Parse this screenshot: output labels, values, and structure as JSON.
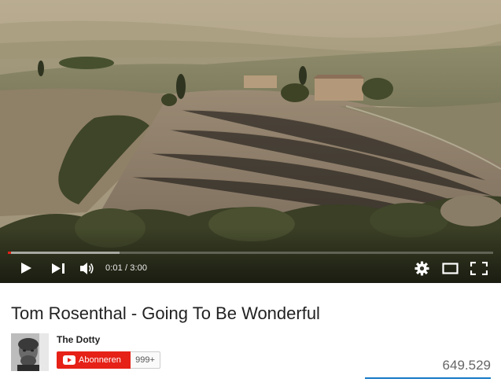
{
  "player": {
    "current_time": "0:01",
    "duration": "3:00",
    "time_display": "0:01 / 3:00",
    "progress_fraction": 0.006,
    "buffered_fraction": 0.23,
    "accent_color": "#e62117",
    "controls": {
      "play": "play-icon",
      "next": "next-icon",
      "volume": "volume-icon",
      "settings": "gear-icon",
      "theater": "theater-mode-icon",
      "fullscreen": "fullscreen-icon"
    }
  },
  "video": {
    "title": "Tom Rosenthal - Going To Be Wonderful",
    "channel": "The Dotty",
    "subscribe_label": "Abonneren",
    "subscriber_count": "999+",
    "views": "649.529"
  },
  "colors": {
    "subscribe": "#e62117",
    "sentiment_bar": "#167ac6"
  }
}
